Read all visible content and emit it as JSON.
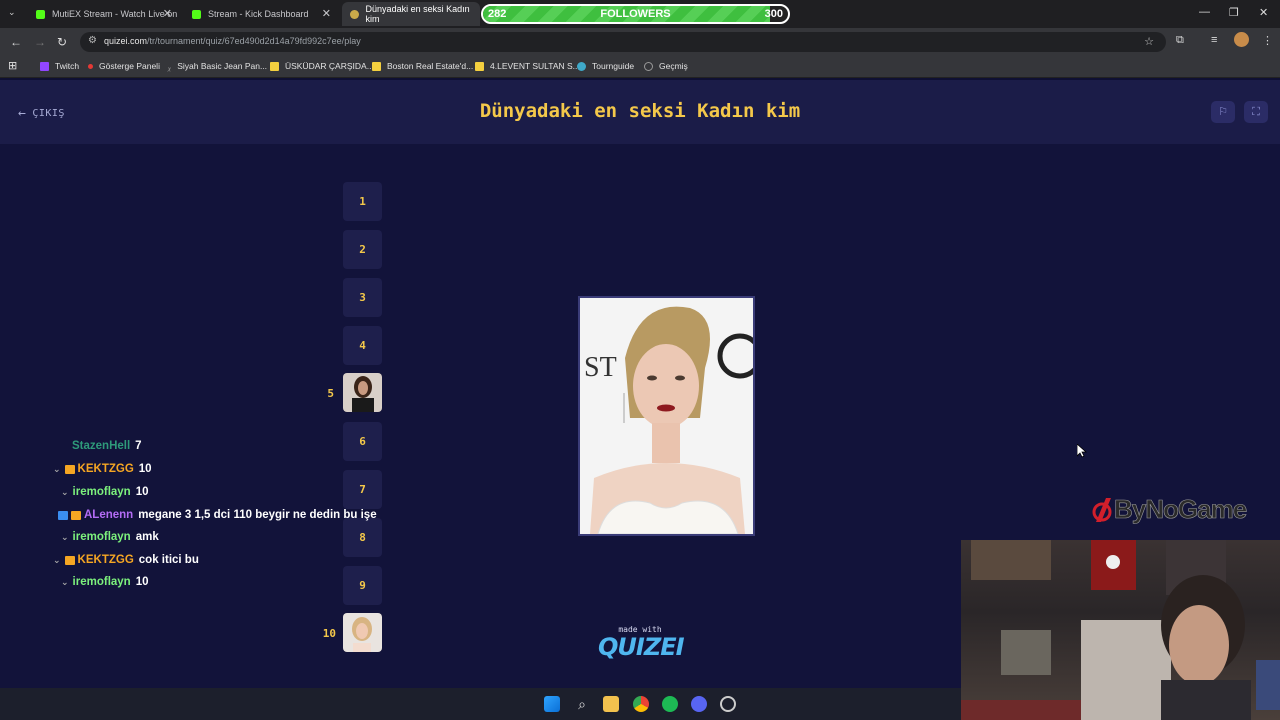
{
  "browser": {
    "tabs": [
      {
        "title": "MutiEX Stream - Watch Live on",
        "color": "#53fc18"
      },
      {
        "title": "Stream - Kick Dashboard",
        "color": "#53fc18"
      },
      {
        "title": "Dünyadaki en seksi Kadın kim",
        "color": "#c9a94a"
      }
    ],
    "url_host": "quizei.com",
    "url_path": "/tr/tournament/quiz/67ed490d2d14a79fd992c7ee/play",
    "bookmarks": [
      {
        "label": "Twitch",
        "color": "#9146ff"
      },
      {
        "label": "Gösterge Paneli",
        "color": "#e53935"
      },
      {
        "label": "Siyah Basic Jean Pan...",
        "color": "#666666"
      },
      {
        "label": "ÜSKÜDAR ÇARŞIDA...",
        "color": "#f4d03f"
      },
      {
        "label": "Boston Real Estate'd...",
        "color": "#f4d03f"
      },
      {
        "label": "4.LEVENT SULTAN S...",
        "color": "#f4d03f"
      },
      {
        "label": "Tournguide",
        "color": "#3fa9c9"
      },
      {
        "label": "Geçmiş",
        "color": "#999999"
      }
    ]
  },
  "followers_goal": {
    "current": "282",
    "label": "FOLLOWERS",
    "target": "300",
    "progress": 0.94
  },
  "quiz": {
    "exit_label": "ÇIKIŞ",
    "title": "Dünyadaki en seksi Kadın kim",
    "slots": [
      "1",
      "2",
      "3",
      "4",
      "5",
      "6",
      "7",
      "8",
      "9",
      "10"
    ],
    "filled_slots": [
      "5",
      "10"
    ],
    "made_with": "made with",
    "brand": "QUIZEI"
  },
  "chat": [
    {
      "user": "StazenHell",
      "text": "7",
      "color": "#2e9a7a",
      "badges": []
    },
    {
      "user": "KEKTZGG",
      "text": "10",
      "color": "#f5a623",
      "badges": [
        "#f5a623"
      ]
    },
    {
      "user": "iremoflayn",
      "text": "10",
      "color": "#7cf07c",
      "badges": []
    },
    {
      "user": "ALenenn",
      "text": "megane 3 1,5 dci 110 beygir ne dedin bu işe",
      "color": "#b36cf5",
      "badges": [
        "#3a8df0",
        "#f5a623"
      ]
    },
    {
      "user": "iremoflayn",
      "text": "amk",
      "color": "#7cf07c",
      "badges": []
    },
    {
      "user": "KEKTZGG",
      "text": "cok itici bu",
      "color": "#f5a623",
      "badges": [
        "#f5a623"
      ]
    },
    {
      "user": "iremoflayn",
      "text": "10",
      "color": "#7cf07c",
      "badges": []
    }
  ],
  "overlay_brand": "ByNoGame"
}
